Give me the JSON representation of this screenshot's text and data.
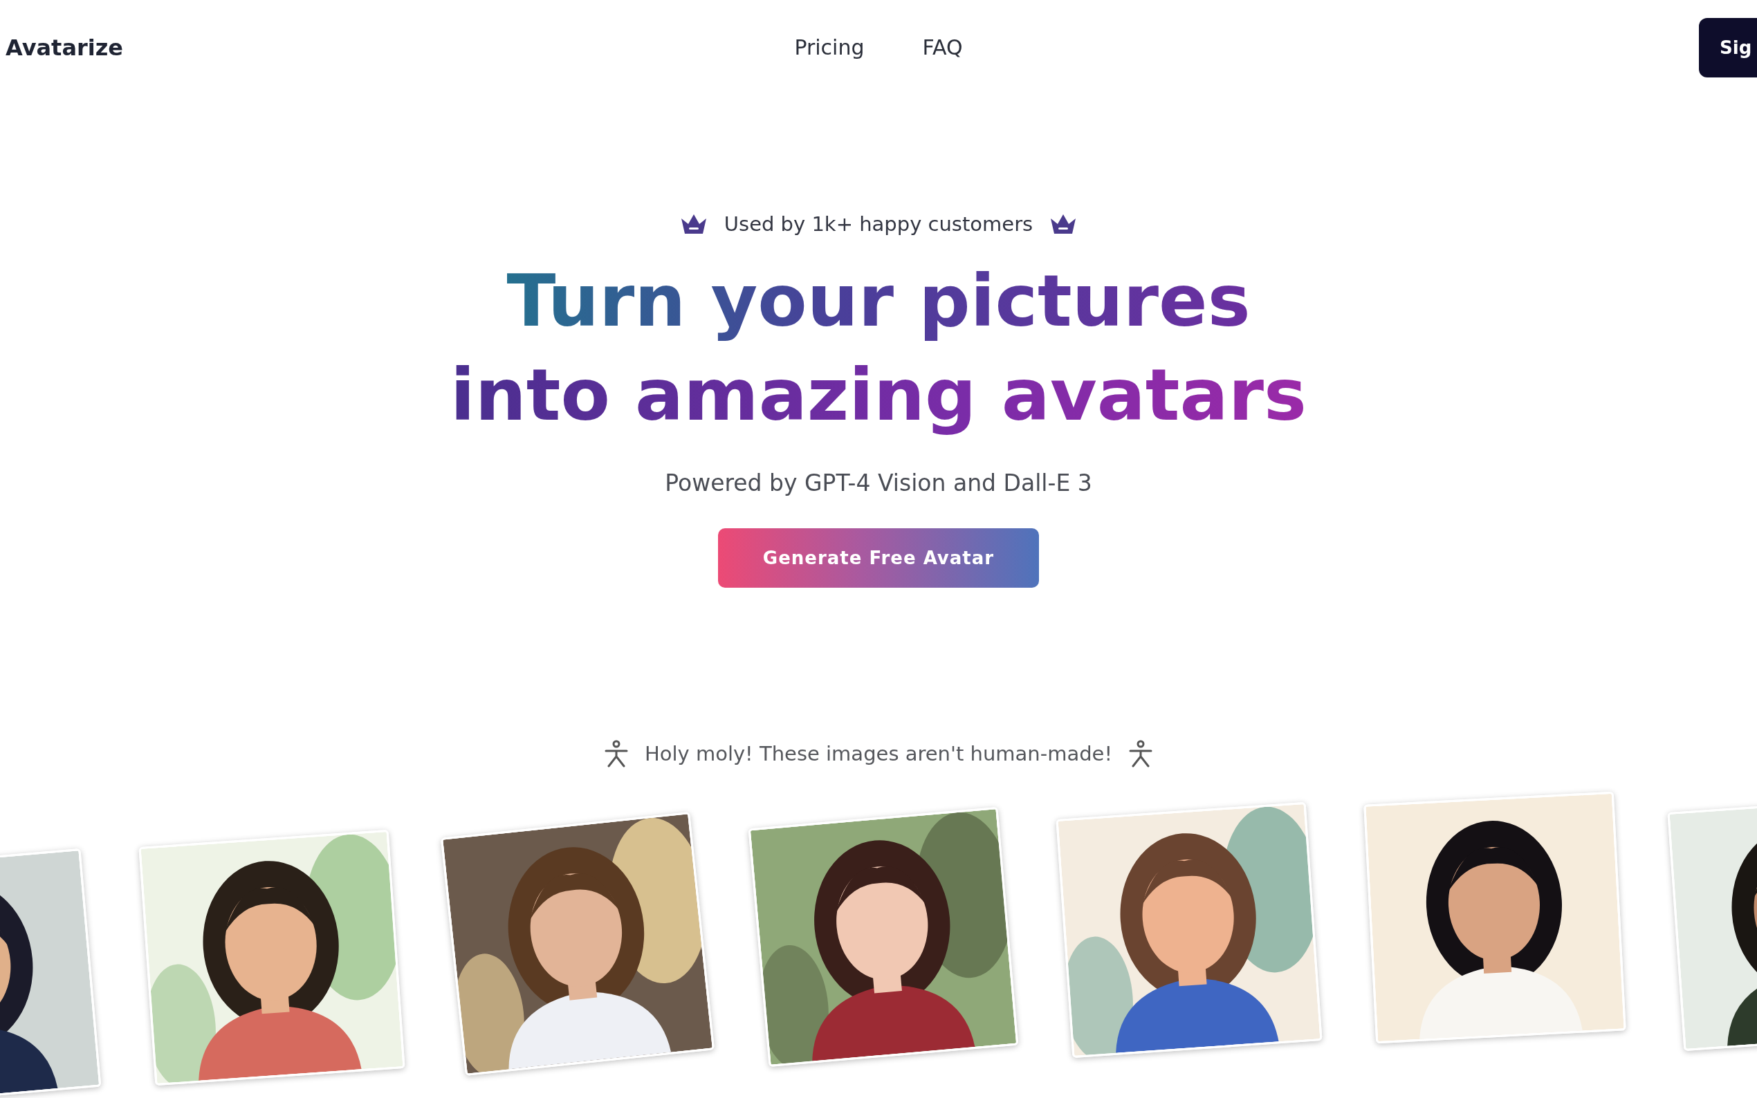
{
  "nav": {
    "logo": "Avatarize",
    "links": [
      "Pricing",
      "FAQ"
    ],
    "button": "Sig"
  },
  "hero": {
    "badge": "Used by 1k+ happy customers",
    "title_lines": [
      "Turn your pictures",
      "into amazing avatars"
    ],
    "subtitle": "Powered by GPT-4 Vision and Dall-E 3",
    "cta": "Generate Free Avatar"
  },
  "gallery": {
    "caption": "Holy moly! These images aren't human-made!"
  }
}
